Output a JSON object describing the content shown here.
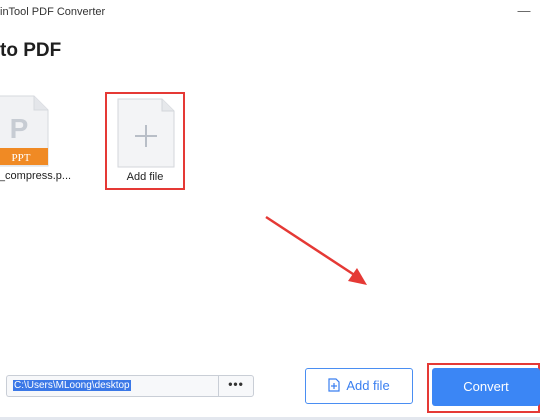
{
  "window": {
    "title": "inTool PDF Converter",
    "minimize_label": "—"
  },
  "page": {
    "heading": "to PDF"
  },
  "files": [
    {
      "name": "_compress.p...",
      "type_badge": "PPT",
      "thumb_letter": "P",
      "badge_color": "#f08a24"
    }
  ],
  "add_tile": {
    "label": "Add file"
  },
  "bottom_bar": {
    "output_path": "C:\\Users\\MLoong\\desktop",
    "browse_label": "•••",
    "add_file_label": "Add file",
    "convert_label": "Convert"
  },
  "colors": {
    "accent": "#3b86f5",
    "highlight_red": "#e53935"
  },
  "icons": [
    "minimize-icon",
    "ppt-file-icon",
    "plus-icon",
    "add-file-icon",
    "arrow-annotation"
  ]
}
